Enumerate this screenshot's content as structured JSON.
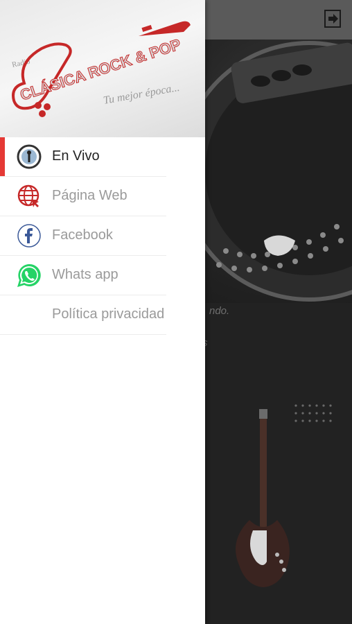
{
  "background": {
    "text_line_1": "ndo.",
    "text_line_2": "s"
  },
  "header": {
    "logo_prefix": "Radio",
    "logo_title": "CLÁSICA ROCK & POP",
    "logo_tagline": "Tu mejor época..."
  },
  "menu": {
    "items": [
      {
        "label": "En Vivo",
        "icon": "live-radio-icon",
        "active": true
      },
      {
        "label": "Página Web",
        "icon": "globe-icon",
        "active": false
      },
      {
        "label": "Facebook",
        "icon": "facebook-icon",
        "active": false
      },
      {
        "label": "Whats app",
        "icon": "whatsapp-icon",
        "active": false
      },
      {
        "label": "Política privacidad",
        "icon": "",
        "active": false
      }
    ]
  },
  "colors": {
    "accent": "#e53935",
    "facebook": "#3b5998",
    "whatsapp": "#25d366",
    "logo_red": "#c62828"
  }
}
